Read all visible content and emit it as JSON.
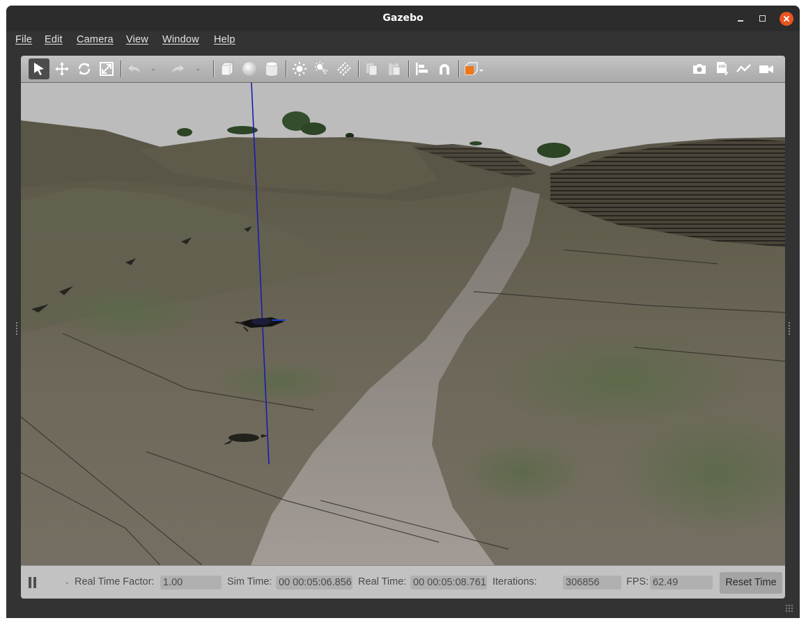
{
  "window": {
    "title": "Gazebo"
  },
  "menu": [
    "File",
    "Edit",
    "Camera",
    "View",
    "Window",
    "Help"
  ],
  "toolbar": {
    "left_tools": [
      "select-arrow-icon",
      "translate-icon",
      "rotate-icon",
      "scale-icon",
      "undo-icon",
      "undo-dropdown-icon",
      "redo-icon",
      "redo-dropdown-icon",
      "box-icon",
      "sphere-icon",
      "cylinder-icon",
      "point-light-icon",
      "spot-light-icon",
      "directional-light-icon",
      "copy-icon",
      "paste-icon",
      "align-icon",
      "snap-magnet-icon",
      "view-angle-icon"
    ],
    "right_tools": [
      "screenshot-camera-icon",
      "log-icon",
      "plot-icon",
      "video-record-icon"
    ]
  },
  "status": {
    "rtf_label": "Real Time Factor:",
    "rtf_value": "1.00",
    "sim_label": "Sim Time:",
    "sim_value": "00 00:05:06.856",
    "real_label": "Real Time:",
    "real_value": "00 00:05:08.761",
    "iter_label": "Iterations:",
    "iter_value": "306856",
    "fps_label": "FPS:",
    "fps_value": "62.49",
    "reset_label": "Reset Time"
  },
  "colors": {
    "close_button": "#e95420",
    "accent_box": "#f07818",
    "sky": "#bdbdbd"
  }
}
